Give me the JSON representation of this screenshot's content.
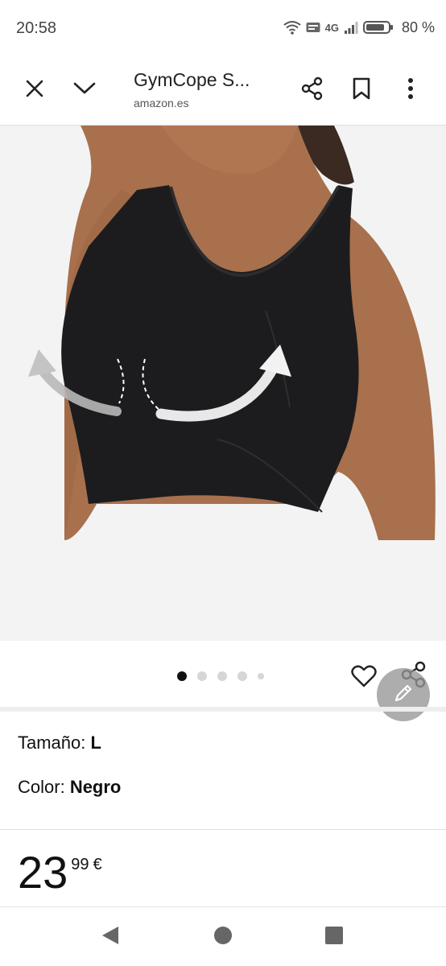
{
  "status_bar": {
    "time": "20:58",
    "network": "4G",
    "battery": "80 %",
    "icons": [
      "wifi-icon",
      "volte-icon",
      "signal-icon",
      "battery-icon"
    ]
  },
  "toolbar": {
    "title": "GymCope S...",
    "url": "amazon.es",
    "icons": [
      "close-icon",
      "chevron-down-icon",
      "share-icon",
      "bookmark-icon",
      "more-vert-icon"
    ]
  },
  "gallery": {
    "image_description": "",
    "page_count": 5,
    "active_page": 1
  },
  "options": {
    "size_label": "Tamaño:",
    "size_value": "L",
    "color_label": "Color:",
    "color_value": "Negro"
  },
  "price": {
    "whole": "23",
    "fraction": "99",
    "currency": "€"
  },
  "colors": {
    "image_bg": "#f3f3f3",
    "fab": "#9a9a9a",
    "garment": "#1c1c1e"
  }
}
